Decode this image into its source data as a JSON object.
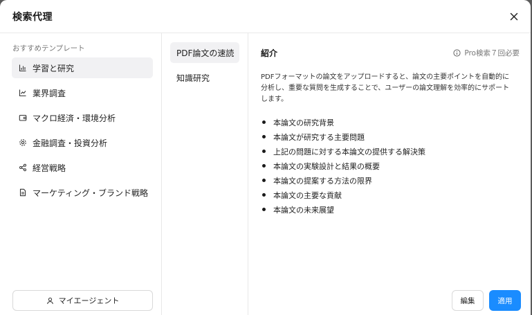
{
  "dialog": {
    "title": "検索代理"
  },
  "sidebar": {
    "section_label": "おすすめテンプレート",
    "items": [
      {
        "label": "学習と研究",
        "icon": "bar-chart-icon",
        "active": true
      },
      {
        "label": "業界調査",
        "icon": "line-chart-icon",
        "active": false
      },
      {
        "label": "マクロ経済・環境分析",
        "icon": "wallet-icon",
        "active": false
      },
      {
        "label": "金融調査・投資分析",
        "icon": "gear-icon",
        "active": false
      },
      {
        "label": "経営戦略",
        "icon": "share-icon",
        "active": false
      },
      {
        "label": "マーケティング・ブランド戦略",
        "icon": "document-icon",
        "active": false
      }
    ],
    "agent_button": "マイエージェント"
  },
  "templates": {
    "items": [
      {
        "label": "PDF論文の速読",
        "active": true
      },
      {
        "label": "知識研究",
        "active": false
      }
    ]
  },
  "detail": {
    "title": "紹介",
    "pro_note": "Pro検索７回必要",
    "description": "PDFフォーマットの論文をアップロードすると、論文の主要ポイントを自動的に分析し、重要な質問を生成することで、ユーザーの論文理解を効率的にサポートします。",
    "points": [
      "本論文の研究背景",
      "本論文が研究する主要問題",
      "上記の問題に対する本論文の提供する解決策",
      "本論文の実験設計と結果の概要",
      "本論文の提案する方法の限界",
      "本論文の主要な貢献",
      "本論文の未来展望"
    ]
  },
  "actions": {
    "edit": "編集",
    "apply": "適用"
  },
  "colors": {
    "accent": "#1a8cff",
    "active_bg": "#f1f1f3"
  }
}
